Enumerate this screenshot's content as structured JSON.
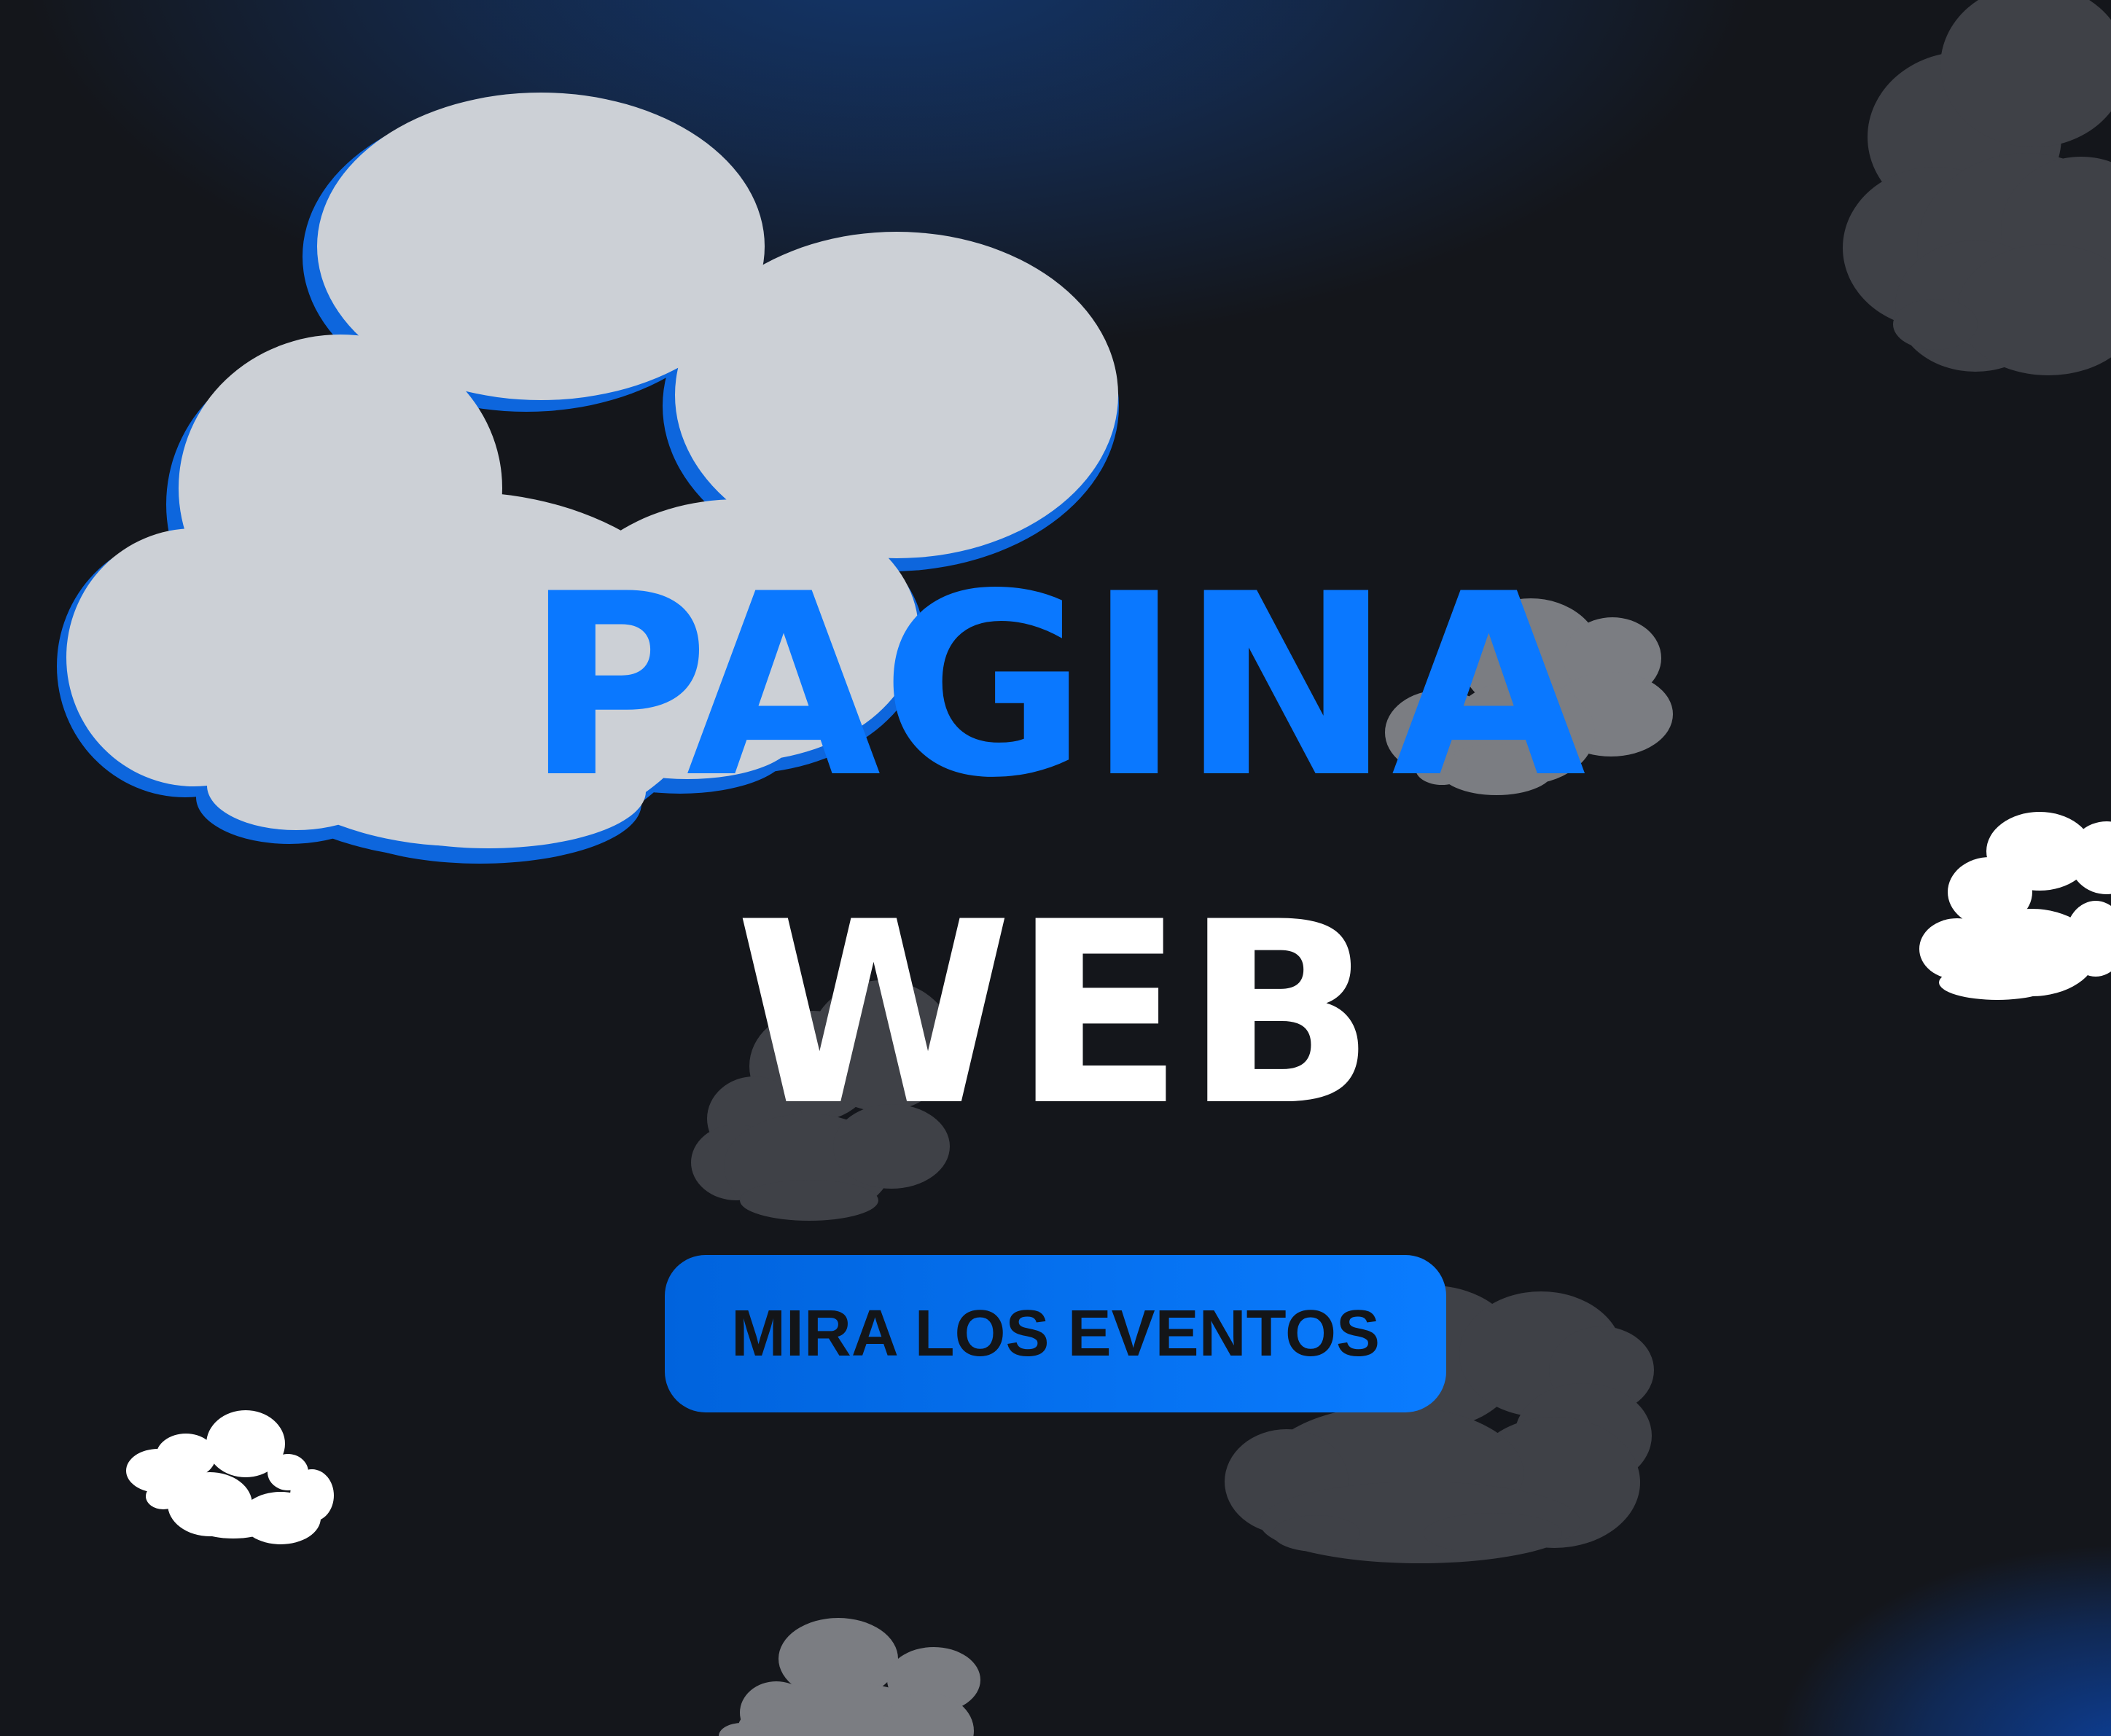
{
  "hero": {
    "title_top": "PAGINA",
    "title_bottom": "WEB"
  },
  "cta": {
    "label": "MIRA LOS EVENTOS"
  },
  "colors": {
    "background": "#14161b",
    "glow": "#13376e",
    "accent_blue": "#0a78ff",
    "cloud_large": "#ccd0d6",
    "cloud_gray": "#3f4147",
    "cloud_light_gray": "#7b7d82",
    "cloud_white": "#ffffff",
    "text_white": "#ffffff",
    "button_text": "#131518"
  },
  "decorations": [
    "large-cloud-icon",
    "gray-cloud-icon",
    "white-cloud-icon"
  ]
}
